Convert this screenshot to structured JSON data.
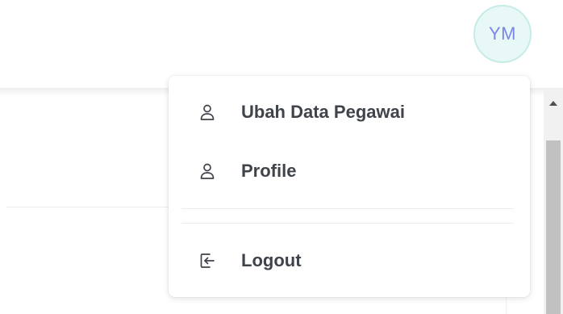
{
  "header": {
    "avatar_initials": "YM"
  },
  "dropdown": {
    "items": [
      {
        "label": "Ubah Data Pegawai",
        "icon": "user-icon"
      },
      {
        "label": "Profile",
        "icon": "user-icon"
      },
      {
        "label": "Logout",
        "icon": "logout-icon"
      }
    ]
  },
  "colors": {
    "avatar_text": "#7b86e8",
    "avatar_bg": "#e8f8f6",
    "menu_text": "#3f434a"
  }
}
